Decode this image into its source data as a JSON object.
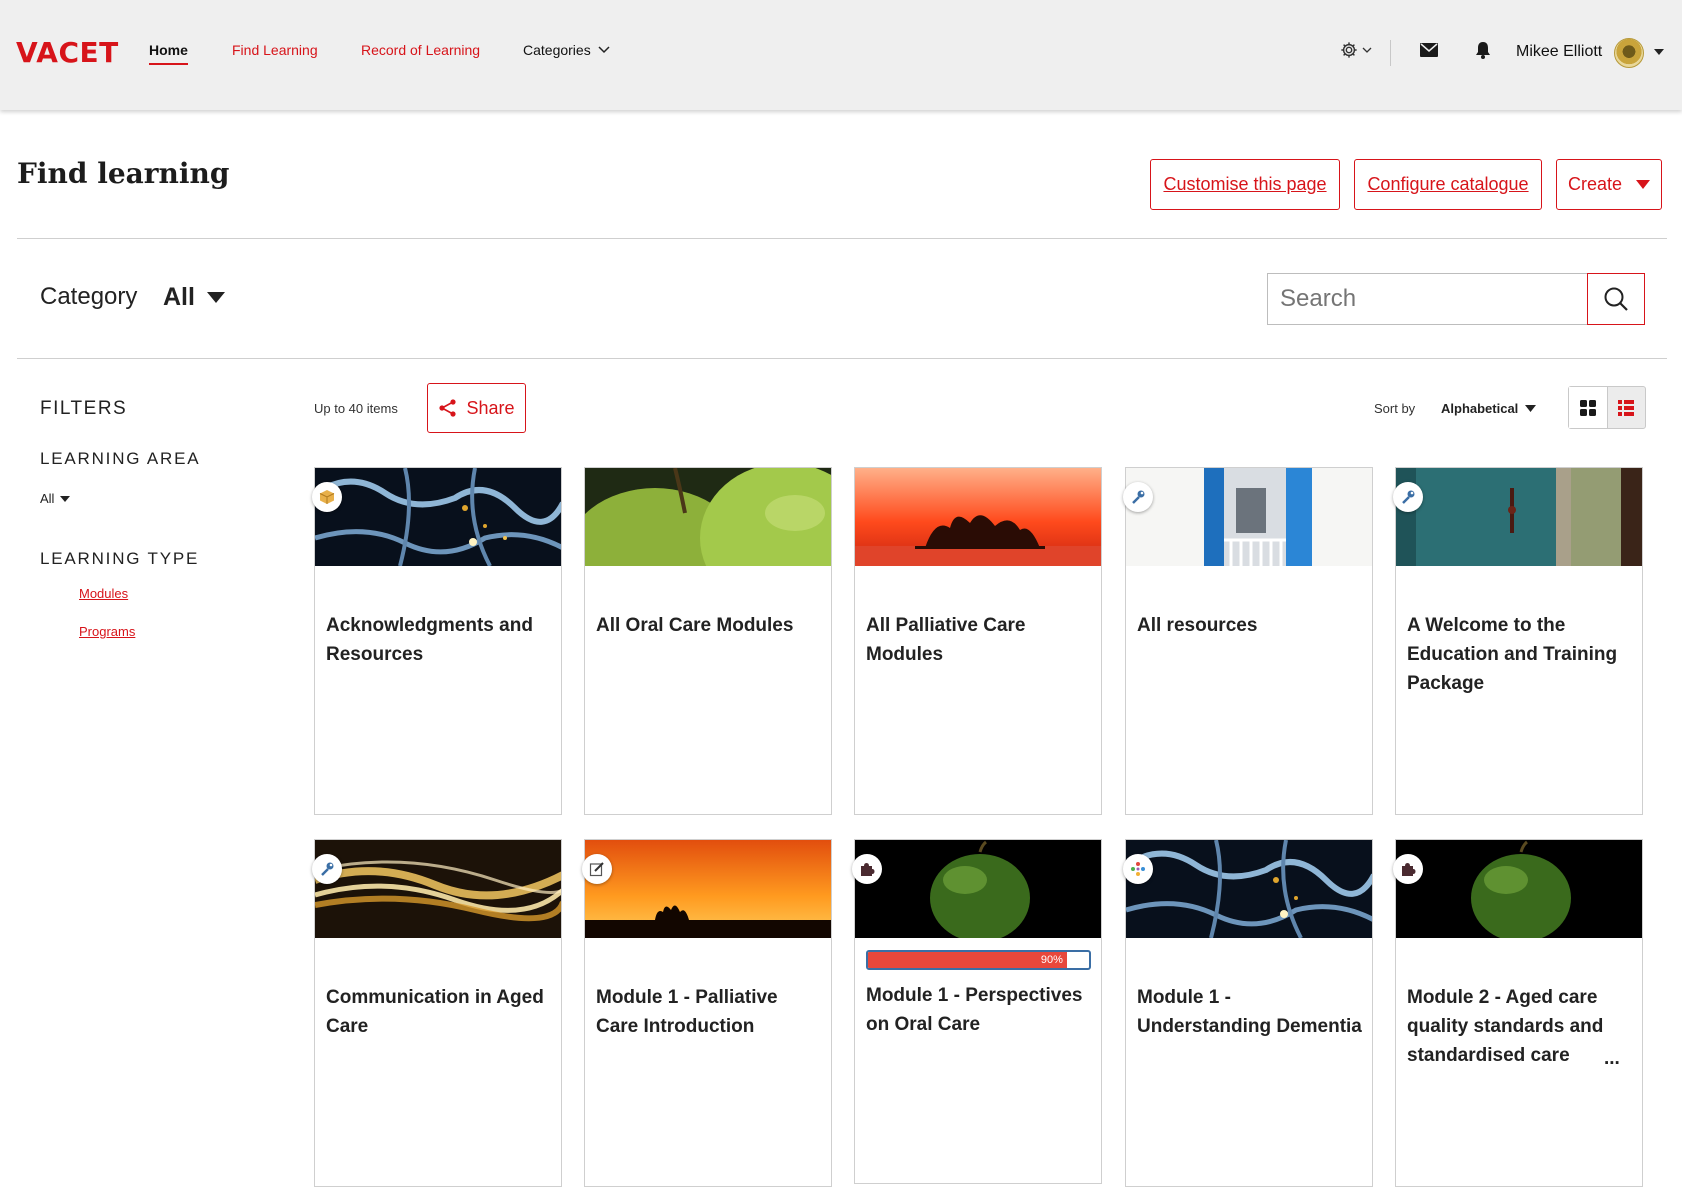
{
  "brand": {
    "logo": "VACET",
    "accent": "#d7141a"
  },
  "nav": {
    "items": [
      {
        "label": "Home",
        "active": true
      },
      {
        "label": "Find Learning"
      },
      {
        "label": "Record of Learning"
      },
      {
        "label": "Categories"
      }
    ],
    "user_name": "Mikee Elliott",
    "icons": [
      "gear-icon",
      "mail-icon",
      "bell-icon",
      "avatar"
    ]
  },
  "header": {
    "title": "Find learning",
    "buttons": {
      "customise": "Customise this page",
      "configure": "Configure catalogue",
      "create": "Create"
    }
  },
  "category": {
    "label": "Category",
    "value": "All"
  },
  "search": {
    "placeholder": "Search"
  },
  "filters": {
    "heading": "FILTERS",
    "learning_area": {
      "heading": "LEARNING AREA",
      "value": "All"
    },
    "learning_type": {
      "heading": "LEARNING TYPE",
      "links": [
        "Modules",
        "Programs"
      ]
    }
  },
  "results": {
    "count_label": "Up to 40 items",
    "share_label": "Share",
    "sort_label": "Sort by",
    "sort_value": "Alphabetical",
    "view": "grid"
  },
  "tiles": [
    {
      "title": "Acknowledgments and Resources",
      "icon": "package-icon"
    },
    {
      "title": "All Oral Care Modules",
      "icon": ""
    },
    {
      "title": "All Palliative Care Modules",
      "icon": ""
    },
    {
      "title": "All resources",
      "icon": "wrench-icon"
    },
    {
      "title": "A Welcome to the Education and Training Package",
      "icon": "wrench-icon"
    },
    {
      "title": "Communication in Aged Care",
      "icon": "wrench-icon"
    },
    {
      "title": "Module 1 - Palliative Care Introduction",
      "icon": "edit-icon"
    },
    {
      "title": "Module 1 - Perspectives on Oral Care",
      "icon": "puzzle-icon",
      "progress": 90,
      "progress_label": "90%"
    },
    {
      "title": "Module 1 - Understanding Dementia",
      "icon": "dots-icon"
    },
    {
      "title": "Module 2 - Aged care quality standards and standardised care",
      "icon": "puzzle-icon",
      "ellipsis": "..."
    }
  ]
}
